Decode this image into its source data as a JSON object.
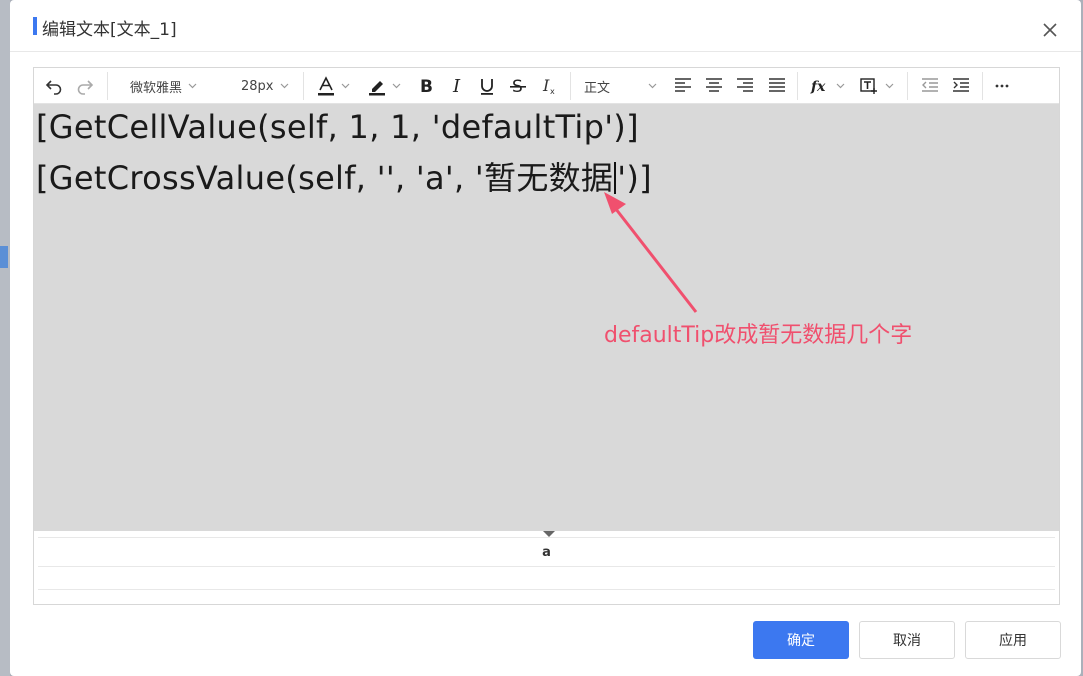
{
  "dialog": {
    "title": "编辑文本[文本_1]"
  },
  "toolbar": {
    "font_family": "微软雅黑",
    "font_size": "28px",
    "paragraph_style": "正文",
    "icons": [
      "undo-icon",
      "redo-icon",
      "font-color-icon",
      "highlight-icon",
      "bold-icon",
      "italic-icon",
      "underline-icon",
      "strikethrough-icon",
      "clear-format-icon",
      "align-left-icon",
      "align-center-icon",
      "align-right-icon",
      "align-justify-icon",
      "formula-icon",
      "insert-field-icon",
      "outdent-icon",
      "indent-icon",
      "more-icon"
    ]
  },
  "content": {
    "line1": "[GetCellValue(self, 1, 1, 'defaultTip')]",
    "line2_before_caret": "[GetCrossValue(self, '', 'a', '暂无数据",
    "line2_after_caret": "')]",
    "annotation": "defaultTip改成暂无数据几个字"
  },
  "preview": {
    "value": "a"
  },
  "footer": {
    "confirm_label": "确定",
    "cancel_label": "取消",
    "apply_label": "应用"
  },
  "colors": {
    "primary": "#3c78f0",
    "annotation": "#f0506e",
    "editor_bg": "#d9d9d9"
  }
}
